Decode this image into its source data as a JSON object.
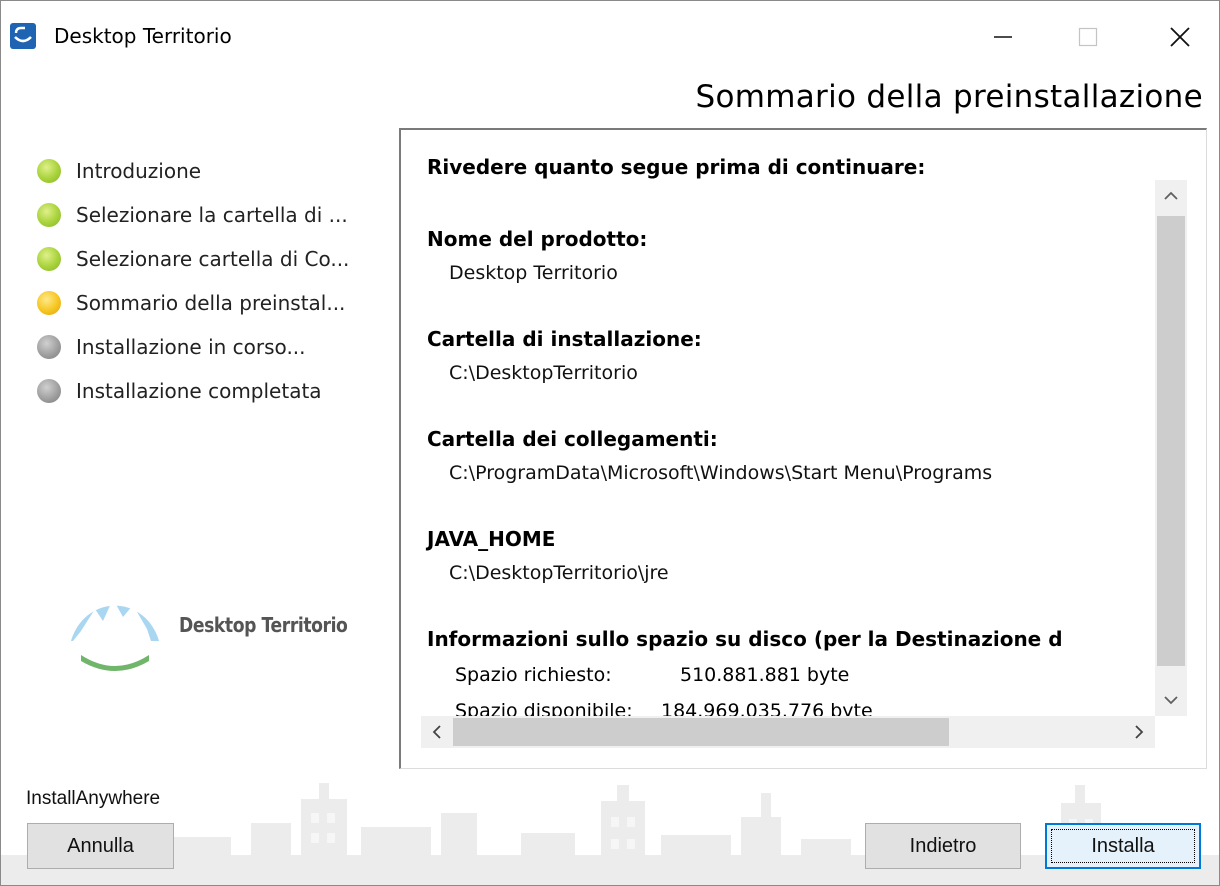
{
  "window": {
    "title": "Desktop Territorio",
    "minimize_icon": "minimize-icon",
    "maximize_icon": "maximize-icon",
    "close_icon": "close-icon"
  },
  "page_title": "Sommario della preinstallazione",
  "steps": [
    {
      "label": "Introduzione",
      "status": "done"
    },
    {
      "label": "Selezionare la cartella di ...",
      "status": "done"
    },
    {
      "label": "Selezionare cartella di Co...",
      "status": "done"
    },
    {
      "label": "Sommario della preinstal...",
      "status": "current"
    },
    {
      "label": "Installazione in corso...",
      "status": "todo"
    },
    {
      "label": "Installazione completata",
      "status": "todo"
    }
  ],
  "status_colors": {
    "done": "#a7d23a",
    "current": "#f5c520",
    "todo": "#9b9b9b"
  },
  "logo": {
    "text": "Desktop Territorio"
  },
  "summary": {
    "intro": "Rivedere quanto segue prima di continuare:",
    "product_title": "Nome del prodotto:",
    "product_value": "Desktop Territorio",
    "install_folder_title": "Cartella di installazione:",
    "install_folder_value": "C:\\DesktopTerritorio",
    "links_folder_title": "Cartella dei collegamenti:",
    "links_folder_value": "C:\\ProgramData\\Microsoft\\Windows\\Start Menu\\Programs",
    "java_title": "JAVA_HOME",
    "java_value": "C:\\DesktopTerritorio\\jre",
    "disk_title": "Informazioni sullo spazio su disco (per la Destinazione d",
    "required_label": "Spazio richiesto:",
    "required_value": "510.881.881 byte",
    "available_label": "Spazio disponibile:",
    "available_value": "184.969.035.776 byte"
  },
  "footer": {
    "vendor": "InstallAnywhere",
    "cancel_label": "Annulla",
    "back_label": "Indietro",
    "install_label": "Installa"
  },
  "accent_color": "#0078d7"
}
